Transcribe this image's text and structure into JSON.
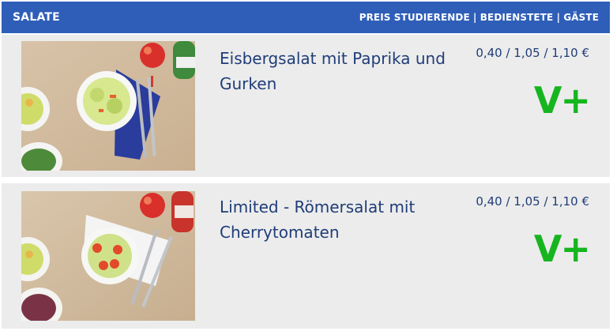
{
  "header": {
    "title": "SALATE",
    "price_legend": "PREIS STUDIERENDE | BEDIENSTETE | GÄSTE"
  },
  "items": [
    {
      "name": "Eisbergsalat mit Paprika und Gurken",
      "price": "0,40 / 1,05 / 1,10 €",
      "badge": "V+"
    },
    {
      "name": "Limited - Römersalat mit Cherrytomaten",
      "price": "0,40 / 1,05 / 1,10 €",
      "badge": "V+"
    }
  ],
  "colors": {
    "header_bg": "#2e5eb8",
    "card_bg": "#ececec",
    "text": "#1f3d78",
    "vegan_badge": "#16b51f"
  }
}
